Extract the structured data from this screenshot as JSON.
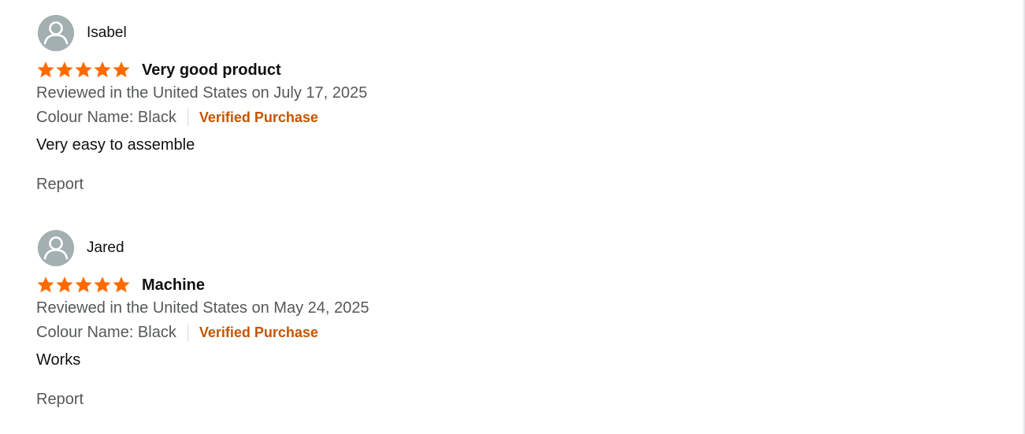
{
  "reviews": [
    {
      "author": "Isabel",
      "rating": 5,
      "rating_max": 5,
      "title": "Very good product",
      "date_line": "Reviewed in the United States on July 17, 2025",
      "format_line": "Colour Name: Black",
      "badge": "Verified Purchase",
      "body": "Very easy to assemble",
      "report_label": "Report"
    },
    {
      "author": "Jared",
      "rating": 5,
      "rating_max": 5,
      "title": "Machine",
      "date_line": "Reviewed in the United States on May 24, 2025",
      "format_line": "Colour Name: Black",
      "badge": "Verified Purchase",
      "body": "Works",
      "report_label": "Report"
    }
  ],
  "icons": {
    "avatar": "user-avatar-icon",
    "star": "star-icon"
  },
  "colors": {
    "star": "#ff6a00",
    "badge": "#c45500",
    "avatar_bg": "#a3afb1",
    "secondary_text": "#565959",
    "primary_text": "#0f1111"
  }
}
